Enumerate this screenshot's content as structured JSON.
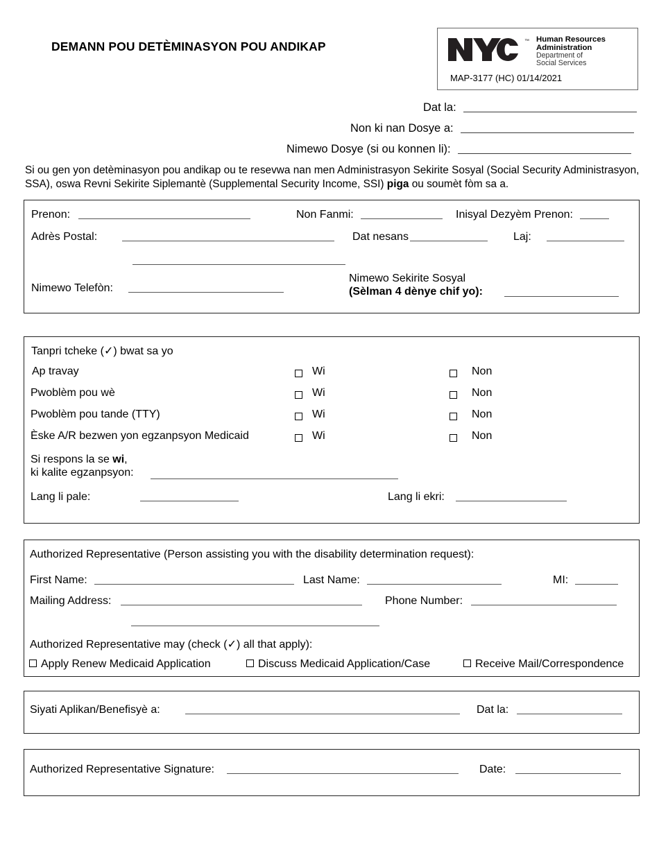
{
  "document": {
    "title": "DEMANN POU DETÈMINASYON POU ANDIKAP",
    "form_code": "MAP-3177 (HC) 01/14/2021"
  },
  "logo": {
    "wordmark": "NYC",
    "trademark": "™",
    "line1": "Human Resources",
    "line2": "Administration",
    "line3": "Department of",
    "line4": "Social Services"
  },
  "header_fields": [
    {
      "label": "Dat la:",
      "value": ""
    },
    {
      "label": "Non ki nan Dosye a:",
      "value": ""
    },
    {
      "label": "Nimewo Dosye (si ou konnen li):",
      "value": ""
    }
  ],
  "intro": {
    "part1": "Si ou gen yon detèminasyon pou andikap ou te resevwa nan men Administrasyon Sekirite Sosyal (Social Security Administrasyon, SSA), oswa Revni Sekirite Siplemantè (Supplemental Security Income, SSI) ",
    "emphasis": "piga",
    "part2": " ou soumèt fòm sa a."
  },
  "applicant_section": {
    "first_name_label": "Prenon:",
    "last_name_label": "Non Fanmi:",
    "middle_initial_label": "Inisyal Dezyèm Prenon:",
    "mailing_address_label": "Adrès Postal:",
    "birth_date_label": "Dat nesans",
    "age_label": "Laj:",
    "phone_label": "Nimewo Telefòn:",
    "ssn_label_line1": "Nimewo Sekirite Sosyal",
    "ssn_label_line2": "(Sèlman 4 dènye chif yo):",
    "values": {
      "first_name": "",
      "last_name": "",
      "middle_initial": "",
      "mailing_address": "",
      "mailing_address_2": "",
      "birth_date": "",
      "age": "",
      "phone": "",
      "ssn_last4": ""
    }
  },
  "checkbox_section": {
    "instruction": "Tanpri tcheke (✓) bwat sa yo",
    "yes_label": "Wi",
    "no_label": "Non",
    "rows": [
      {
        "label": "Ap travay",
        "yes_checked": false,
        "no_checked": false
      },
      {
        "label": "Pwoblèm pou wè",
        "yes_checked": false,
        "no_checked": false
      },
      {
        "label": "Pwoblèm pou tande (TTY)",
        "yes_checked": false,
        "no_checked": false
      },
      {
        "label": "Èske A/R bezwen yon egzanpsyon Medicaid",
        "yes_checked": false,
        "no_checked": false
      }
    ],
    "exemption_prompt_line1_pre": "Si respons la se ",
    "exemption_prompt_line1_em": "wi",
    "exemption_prompt_line1_post": ",",
    "exemption_prompt_line2": "ki kalite egzanpsyon:",
    "exemption_value": "",
    "spoken_language_label": "Lang li pale:",
    "spoken_language_value": "",
    "written_language_label": "Lang li ekri:",
    "written_language_value": ""
  },
  "authorized_rep_section": {
    "heading": "Authorized Representative (Person assisting you with the disability determination request):",
    "first_name_label": "First Name:",
    "last_name_label": "Last Name:",
    "mi_label": "MI:",
    "mailing_address_label": "Mailing Address:",
    "phone_label": "Phone Number:",
    "permissions_label": "Authorized Representative may (check  (✓) all that apply):",
    "permissions": [
      {
        "label": "Apply Renew Medicaid Application",
        "checked": false
      },
      {
        "label": "Discuss Medicaid Application/Case",
        "checked": false
      },
      {
        "label": "Receive Mail/Correspondence",
        "checked": false
      }
    ],
    "values": {
      "first_name": "",
      "last_name": "",
      "mi": "",
      "mailing_address": "",
      "mailing_address_2": "",
      "phone": ""
    }
  },
  "applicant_signature_section": {
    "label": "Siyati Aplikan/Benefisyè a:",
    "date_label": "Dat la:",
    "signature_value": "",
    "date_value": ""
  },
  "rep_signature_section": {
    "label": "Authorized Representative Signature:",
    "date_label": "Date:",
    "signature_value": "",
    "date_value": ""
  },
  "colors": {
    "ink": "#000000",
    "rule": "#555555",
    "border": "#222222",
    "logo_box_border": "#666666"
  }
}
